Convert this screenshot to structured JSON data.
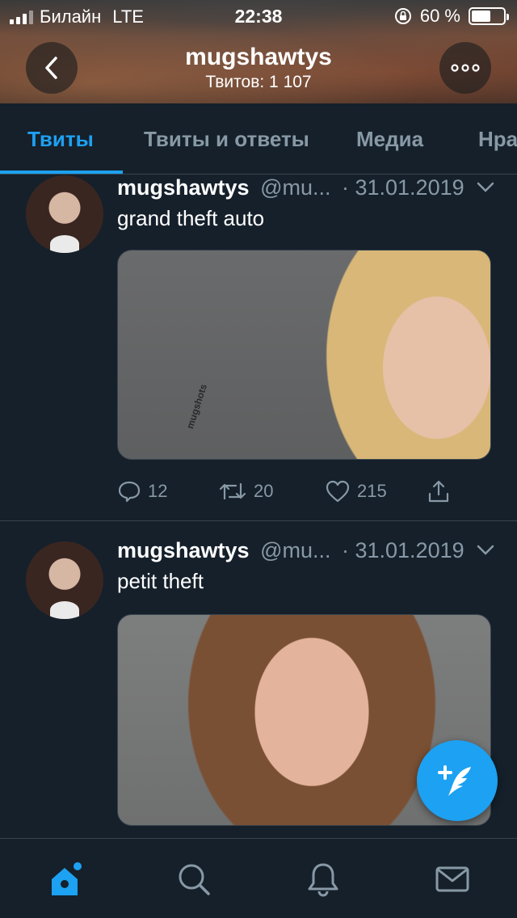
{
  "status_bar": {
    "carrier": "Билайн",
    "network": "LTE",
    "time": "22:38",
    "battery_percent": "60 %",
    "battery_level": 0.6
  },
  "header": {
    "title": "mugshawtys",
    "subtitle": "Твитов: 1 107",
    "back_icon": "chevron-left-icon",
    "more_icon": "more-dots-icon"
  },
  "tabs": [
    {
      "label": "Твиты",
      "active": true
    },
    {
      "label": "Твиты и ответы",
      "active": false
    },
    {
      "label": "Медиа",
      "active": false
    },
    {
      "label": "Нра",
      "active": false
    }
  ],
  "tweets": [
    {
      "name": "mugshawtys",
      "handle": "@mu...",
      "date": "· 31.01.2019",
      "text": "grand theft auto",
      "media_watermark": "mugshots",
      "replies": "12",
      "retweets": "20",
      "likes": "215"
    },
    {
      "name": "mugshawtys",
      "handle": "@mu...",
      "date": "· 31.01.2019",
      "text": "petit theft"
    }
  ],
  "colors": {
    "background": "#15202b",
    "accent": "#1da1f2",
    "muted": "#8899a6",
    "divider": "#38444d"
  },
  "bottom_nav": [
    "home-icon",
    "search-icon",
    "notifications-icon",
    "messages-icon"
  ]
}
